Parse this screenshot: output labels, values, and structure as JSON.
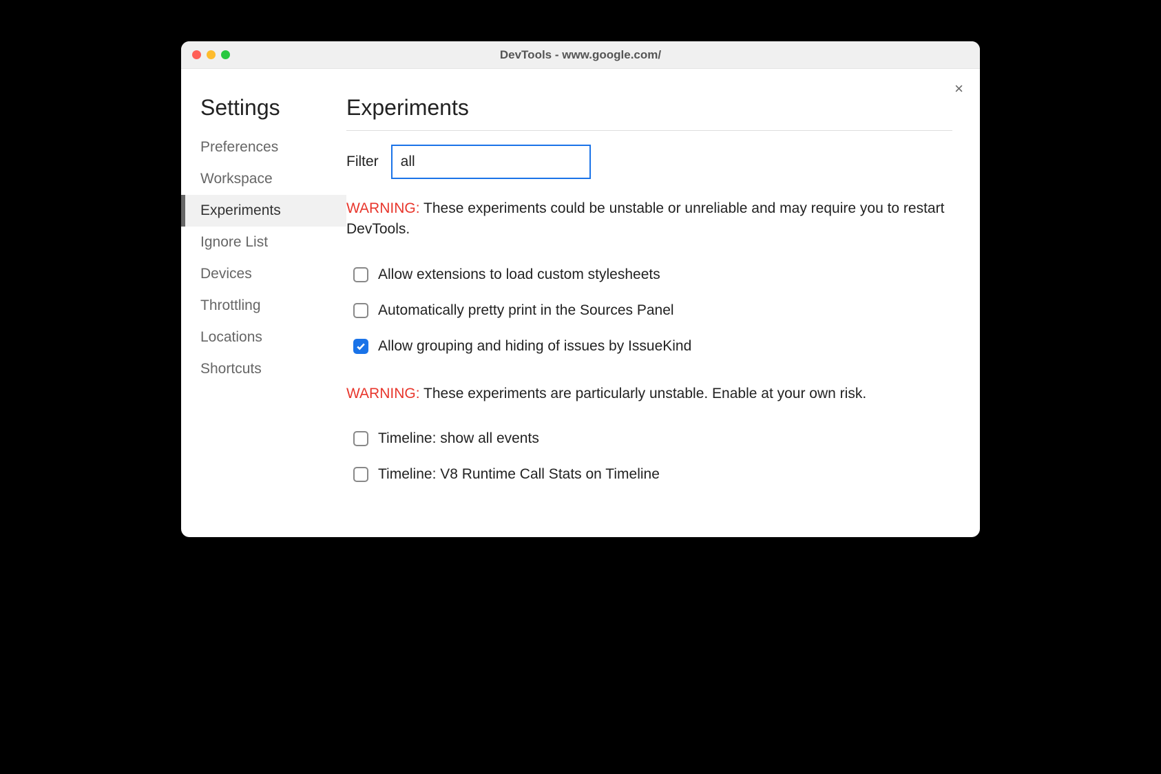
{
  "window": {
    "title": "DevTools - www.google.com/"
  },
  "close_label": "×",
  "sidebar": {
    "title": "Settings",
    "items": [
      {
        "label": "Preferences",
        "active": false
      },
      {
        "label": "Workspace",
        "active": false
      },
      {
        "label": "Experiments",
        "active": true
      },
      {
        "label": "Ignore List",
        "active": false
      },
      {
        "label": "Devices",
        "active": false
      },
      {
        "label": "Throttling",
        "active": false
      },
      {
        "label": "Locations",
        "active": false
      },
      {
        "label": "Shortcuts",
        "active": false
      }
    ]
  },
  "main": {
    "title": "Experiments",
    "filter_label": "Filter",
    "filter_value": "all",
    "warning1_label": "WARNING:",
    "warning1_text": " These experiments could be unstable or unreliable and may require you to restart DevTools.",
    "experiments1": [
      {
        "label": "Allow extensions to load custom stylesheets",
        "checked": false
      },
      {
        "label": "Automatically pretty print in the Sources Panel",
        "checked": false
      },
      {
        "label": "Allow grouping and hiding of issues by IssueKind",
        "checked": true
      }
    ],
    "warning2_label": "WARNING:",
    "warning2_text": " These experiments are particularly unstable. Enable at your own risk.",
    "experiments2": [
      {
        "label": "Timeline: show all events",
        "checked": false
      },
      {
        "label": "Timeline: V8 Runtime Call Stats on Timeline",
        "checked": false
      }
    ]
  }
}
